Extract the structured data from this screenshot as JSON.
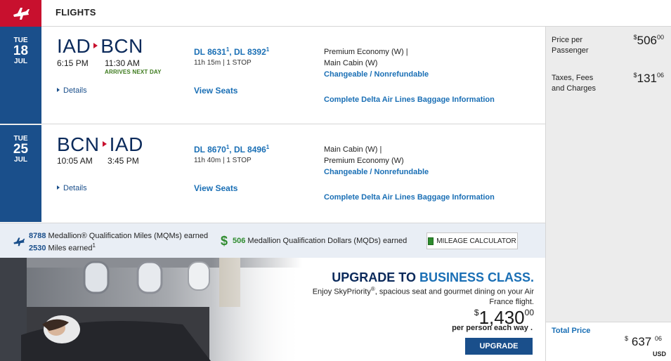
{
  "header": {
    "title": "FLIGHTS",
    "logo_icon": "airplane-icon",
    "brand_color": "#c8102e"
  },
  "flights": [
    {
      "date": {
        "dow": "TUE",
        "day": "18",
        "month": "JUL"
      },
      "origin": "IAD",
      "destination": "BCN",
      "depart_time": "6:15 PM",
      "arrive_time": "11:30 AM",
      "arrives_note": "ARRIVES NEXT DAY",
      "flight_a": "DL 8631",
      "flight_a_note": "1",
      "flight_b": "DL 8392",
      "flight_b_note": "1",
      "duration": "11h 15m | 1 STOP",
      "cabin_1": "Premium Economy (W) |",
      "cabin_2": "Main Cabin (W)",
      "fare_rules": "Changeable / Nonrefundable",
      "details": "Details",
      "view_seats": "View Seats",
      "baggage": "Complete Delta Air Lines Baggage Information"
    },
    {
      "date": {
        "dow": "TUE",
        "day": "25",
        "month": "JUL"
      },
      "origin": "BCN",
      "destination": "IAD",
      "depart_time": "10:05 AM",
      "arrive_time": "3:45 PM",
      "flight_a": "DL 8670",
      "flight_a_note": "1",
      "flight_b": "DL 8496",
      "flight_b_note": "1",
      "duration": "11h 40m | 1 STOP",
      "cabin_1": "Main Cabin (W) |",
      "cabin_2": "Premium Economy (W)",
      "fare_rules": "Changeable / Nonrefundable",
      "details": "Details",
      "view_seats": "View Seats",
      "baggage": "Complete Delta Air Lines Baggage Information"
    }
  ],
  "miles": {
    "mqm_value": "8788",
    "mqm_text": "Medallion® Qualification Miles (MQMs) earned",
    "miles_value": "2530",
    "miles_text": "Miles earned",
    "miles_note": "1",
    "mqd_symbol": "$",
    "mqd_value": "506",
    "mqd_text": "Medallion Qualification Dollars (MQDs) earned",
    "calculator_label": "MILEAGE CALCULATOR"
  },
  "upsell": {
    "title_prefix": "UPGRADE TO",
    "title_highlight": "BUSINESS CLASS.",
    "desc_1": "Enjoy SkyPriority",
    "desc_reg": "®",
    "desc_2": ", spacious seat and gourmet dining on your Air France flight.",
    "price_currency": "$",
    "price_main": "1,430",
    "price_cents": "00",
    "per_text": "per person each way .",
    "button_label": "UPGRADE"
  },
  "price_panel": {
    "per_passenger_label_1": "Price per",
    "per_passenger_label_2": "Passenger",
    "per_passenger_currency": "$",
    "per_passenger_main": "506",
    "per_passenger_cents": "00",
    "taxes_label_1": "Taxes, Fees",
    "taxes_label_2": "and Charges",
    "taxes_currency": "$",
    "taxes_main": "131",
    "taxes_cents": "06",
    "total_label": "Total Price",
    "total_currency": "$",
    "total_main": "637",
    "total_cents": "06",
    "total_unit": "USD"
  }
}
